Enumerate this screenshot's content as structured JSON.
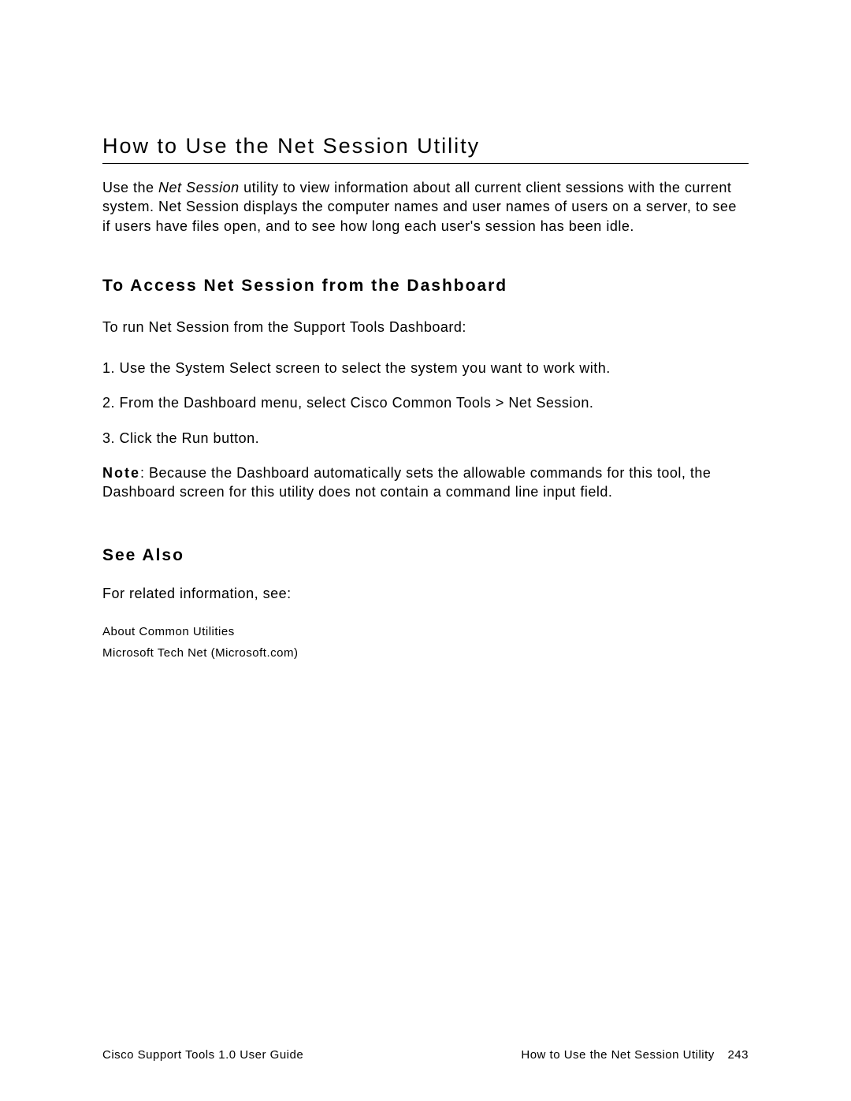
{
  "title": "How to Use the Net Session Utility",
  "intro": {
    "prefix": "Use the ",
    "italic": "Net Session",
    "rest": " utility to view information about all current client sessions with the current system. Net Session displays the computer names and user names of users on a server, to see if users have files open, and to see how long each user's session has been idle."
  },
  "section1": {
    "heading": "To Access Net Session from the Dashboard",
    "lead": "To run Net Session from the Support Tools Dashboard:",
    "steps": [
      "1.  Use the System Select screen to select the system you want to work with.",
      "2.  From the Dashboard menu, select Cisco Common Tools > Net Session.",
      "3.  Click the Run button."
    ],
    "note_label": "Note",
    "note_body": ": Because the Dashboard automatically sets the allowable commands for this tool, the Dashboard screen for this utility does not contain a command line input field."
  },
  "see_also": {
    "heading": "See Also",
    "lead": "For related information, see:",
    "links": [
      "About Common Utilities",
      "Microsoft Tech Net (Microsoft.com)"
    ]
  },
  "footer": {
    "left": "Cisco Support Tools 1.0 User Guide",
    "right_title": "How to Use the Net Session Utility",
    "page": "243"
  }
}
